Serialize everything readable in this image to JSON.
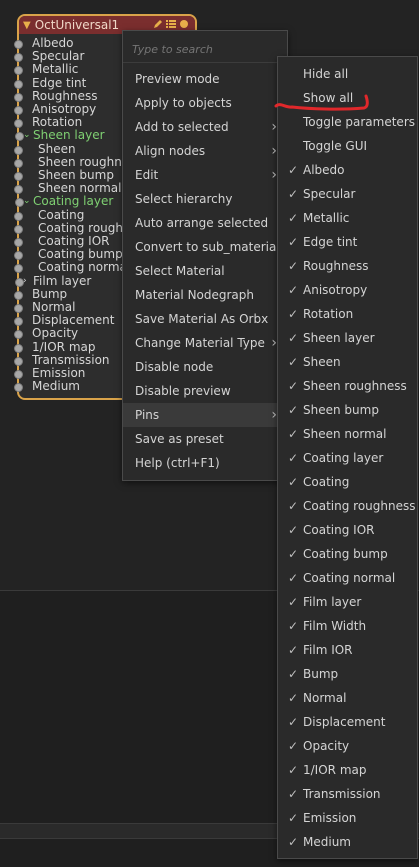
{
  "node": {
    "title": "OctUniversal1",
    "pins": [
      {
        "label": "Albedo"
      },
      {
        "label": "Specular"
      },
      {
        "label": "Metallic"
      },
      {
        "label": "Edge tint"
      },
      {
        "label": "Roughness"
      },
      {
        "label": "Anisotropy"
      },
      {
        "label": "Rotation"
      },
      {
        "label": "Sheen layer"
      },
      {
        "label": "Sheen"
      },
      {
        "label": "Sheen roughne"
      },
      {
        "label": "Sheen bump"
      },
      {
        "label": "Sheen normal"
      },
      {
        "label": "Coating layer"
      },
      {
        "label": "Coating"
      },
      {
        "label": "Coating rough"
      },
      {
        "label": "Coating IOR"
      },
      {
        "label": "Coating bump"
      },
      {
        "label": "Coating norma"
      },
      {
        "label": "Film layer"
      },
      {
        "label": "Bump"
      },
      {
        "label": "Normal"
      },
      {
        "label": "Displacement"
      },
      {
        "label": "Opacity"
      },
      {
        "label": "1/IOR map"
      },
      {
        "label": "Transmission"
      },
      {
        "label": "Emission"
      },
      {
        "label": "Medium"
      }
    ]
  },
  "context_menu": {
    "search_placeholder": "Type to search",
    "items": [
      "Preview mode",
      "Apply to objects",
      "Add to selected",
      "Align nodes",
      "Edit",
      "Select hierarchy",
      "Auto arrange selected",
      "Convert to sub_material",
      "Select Material",
      "Material Nodegraph",
      "Save Material As Orbx",
      "Change Material Type",
      "Disable node",
      "Disable preview",
      "Pins",
      "Save as preset",
      "Help (ctrl+F1)"
    ]
  },
  "pins_menu": {
    "actions": [
      "Hide all",
      "Show all",
      "Toggle parameters",
      "Toggle GUI"
    ],
    "items": [
      "Albedo",
      "Specular",
      "Metallic",
      "Edge tint",
      "Roughness",
      "Anisotropy",
      "Rotation",
      "Sheen layer",
      "Sheen",
      "Sheen roughness",
      "Sheen bump",
      "Sheen normal",
      "Coating layer",
      "Coating",
      "Coating roughness",
      "Coating IOR",
      "Coating bump",
      "Coating normal",
      "Film layer",
      "Film Width",
      "Film IOR",
      "Bump",
      "Normal",
      "Displacement",
      "Opacity",
      "1/IOR map",
      "Transmission",
      "Emission",
      "Medium"
    ]
  },
  "colors": {
    "node_border": "#d9a34a",
    "node_header": "#7a2e2e",
    "group_label": "#7fd072",
    "annotation": "#e0282b"
  }
}
